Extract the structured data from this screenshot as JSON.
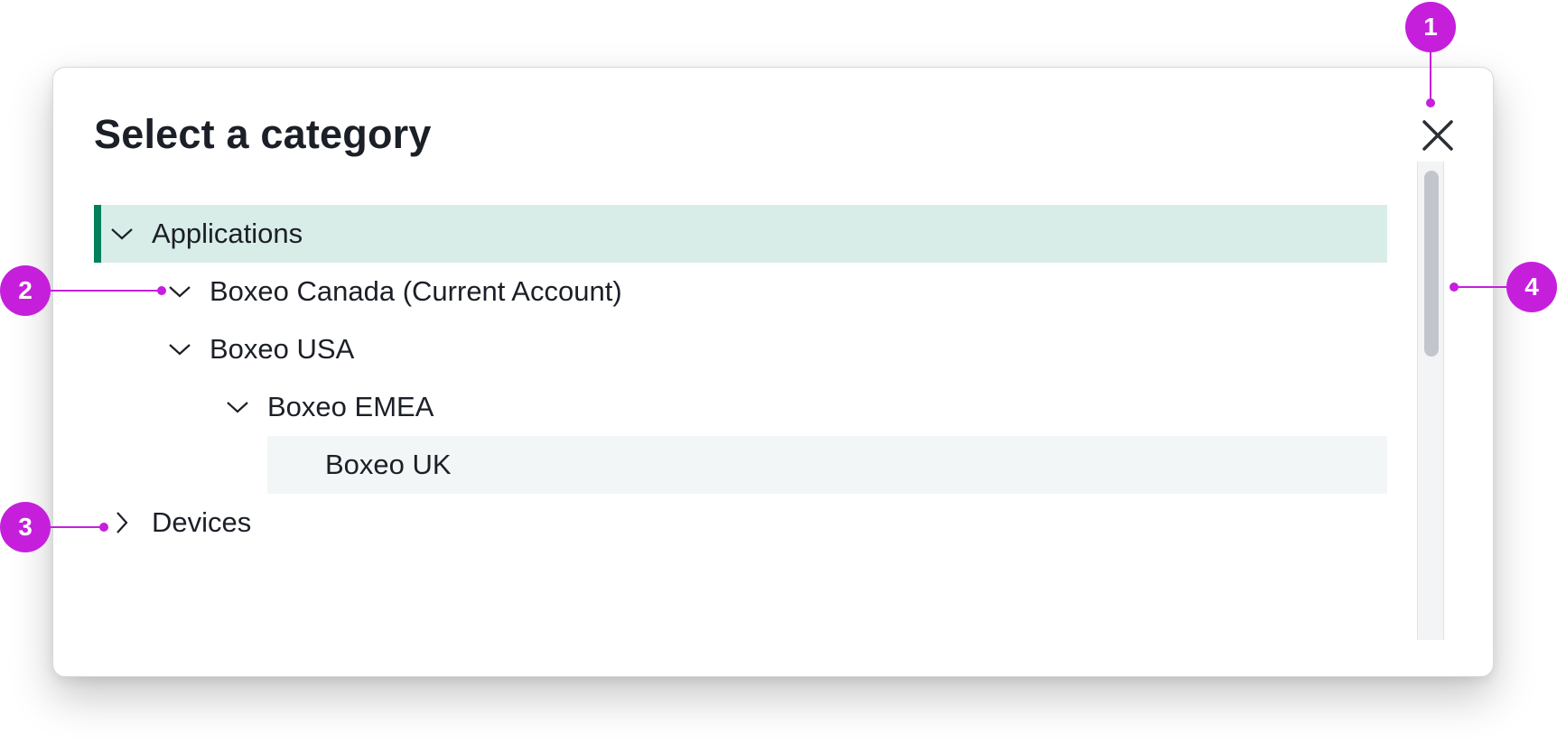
{
  "dialog": {
    "title": "Select a category",
    "close_icon": "close-icon"
  },
  "tree": {
    "items": [
      {
        "label": "Applications",
        "state": "expanded",
        "level": 0,
        "selected": true
      },
      {
        "label": "Boxeo Canada (Current Account)",
        "state": "expanded",
        "level": 1
      },
      {
        "label": "Boxeo USA",
        "state": "expanded",
        "level": 1
      },
      {
        "label": "Boxeo EMEA",
        "state": "expanded",
        "level": 2
      },
      {
        "label": "Boxeo UK",
        "state": "leaf",
        "level": 3,
        "hovered": true
      },
      {
        "label": "Devices",
        "state": "collapsed",
        "level": 0
      }
    ]
  },
  "scrollbar": {
    "position": 0
  },
  "callouts": [
    "1",
    "2",
    "3",
    "4"
  ],
  "colors": {
    "accent": "#00815d",
    "selected_bg": "#d9ede8",
    "hover_bg": "#f3f6f6",
    "callout": "#c51fdc",
    "text": "#1b1f27"
  }
}
